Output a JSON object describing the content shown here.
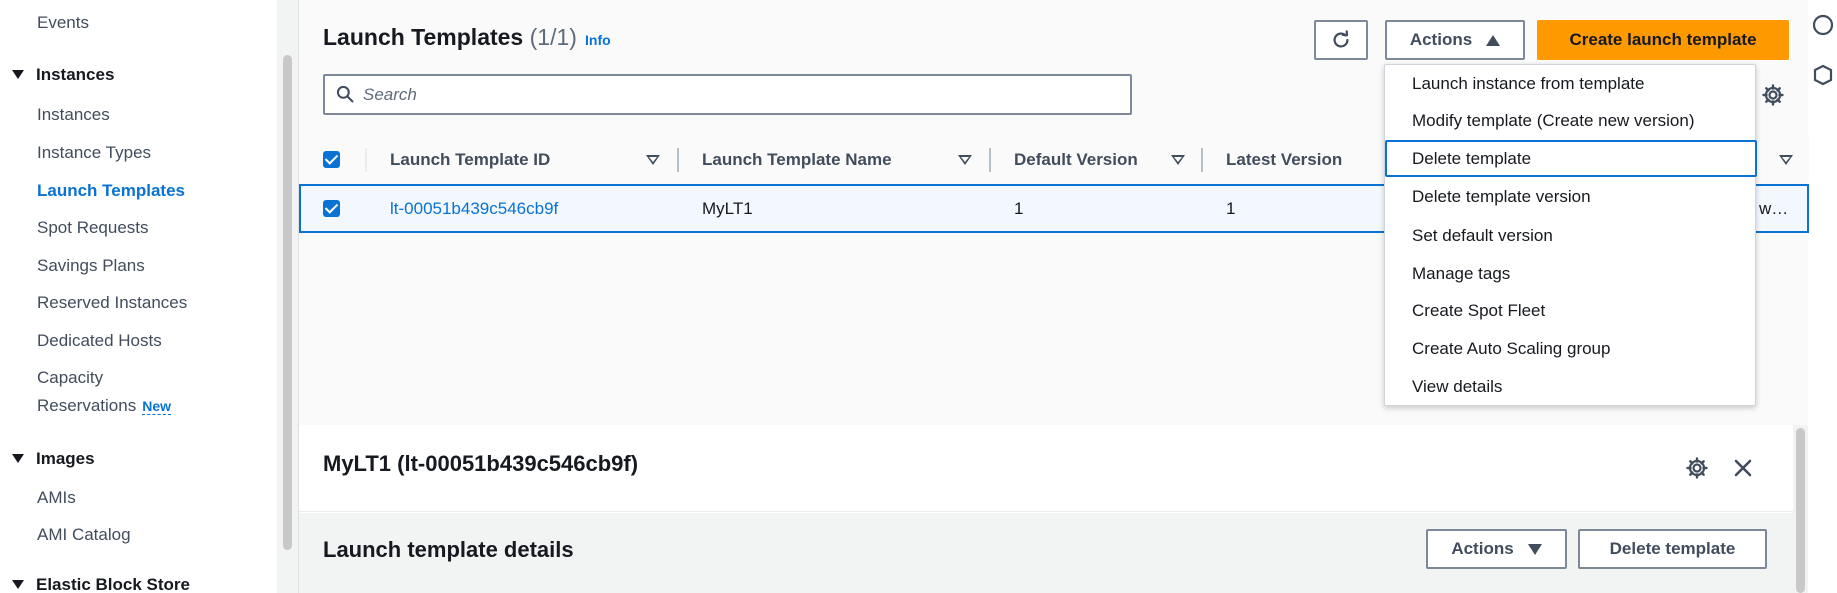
{
  "sidebar": {
    "events": "Events",
    "instances_section": "Instances",
    "instances_items": [
      "Instances",
      "Instance Types",
      "Launch Templates",
      "Spot Requests",
      "Savings Plans",
      "Reserved Instances",
      "Dedicated Hosts"
    ],
    "capacity_line1": "Capacity",
    "capacity_line2": "Reservations",
    "new_badge": "New",
    "images_section": "Images",
    "images_items": [
      "AMIs",
      "AMI Catalog"
    ],
    "ebs_section": "Elastic Block Store"
  },
  "header": {
    "title": "Launch Templates",
    "count": "(1/1)",
    "info": "Info",
    "actions_label": "Actions",
    "create_label": "Create launch template"
  },
  "search": {
    "placeholder": "Search"
  },
  "table": {
    "columns": [
      "Launch Template ID",
      "Launch Template Name",
      "Default Version",
      "Latest Version"
    ],
    "rows": [
      {
        "id": "lt-00051b439c546cb9f",
        "name": "MyLT1",
        "default_version": "1",
        "latest_version": "1",
        "truncated": "w…"
      }
    ]
  },
  "actions_menu": {
    "items": [
      "Launch instance from template",
      "Modify template (Create new version)",
      "Delete template",
      "Delete template version",
      "Set default version",
      "Manage tags",
      "Create Spot Fleet",
      "Create Auto Scaling group",
      "View details"
    ],
    "highlighted": "Delete template"
  },
  "details": {
    "title": "MyLT1 (lt-00051b439c546cb9f)",
    "section_title": "Launch template details",
    "actions_label": "Actions",
    "delete_label": "Delete template"
  },
  "colors": {
    "accent": "#0972d3",
    "primary_button": "#ff9900",
    "row_selected_bg": "#f2f8fd"
  }
}
